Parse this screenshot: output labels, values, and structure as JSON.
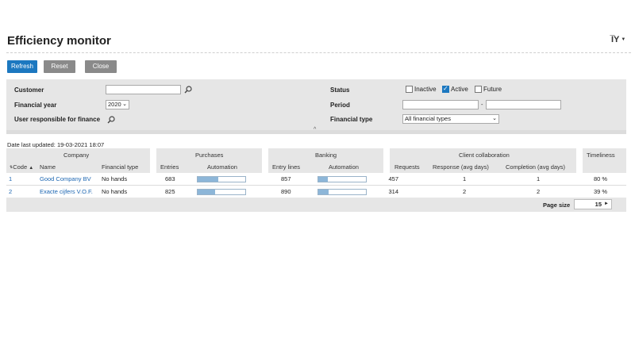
{
  "page": {
    "title": "Efficiency monitor",
    "menu_icon": "language-icon"
  },
  "toolbar": {
    "refresh": "Refresh",
    "reset": "Reset",
    "close": "Close"
  },
  "filters": {
    "customer_label": "Customer",
    "financial_year_label": "Financial year",
    "financial_year_value": "2020",
    "user_responsible_label": "User responsible for finance",
    "status_label": "Status",
    "status_options": [
      {
        "label": "Inactive",
        "checked": false
      },
      {
        "label": "Active",
        "checked": true
      },
      {
        "label": "Future",
        "checked": false
      }
    ],
    "period_label": "Period",
    "period_separator": "-",
    "financial_type_label": "Financial type",
    "financial_type_value": "All financial types",
    "collapse_icon": "^"
  },
  "meta": {
    "date_last_updated": "Date last updated: 19-03-2021 18:07"
  },
  "table": {
    "groups": {
      "company": "Company",
      "purchases": "Purchases",
      "banking": "Banking",
      "client_collaboration": "Client collaboration",
      "timeliness": "Timeliness"
    },
    "columns": {
      "code": "Code",
      "name": "Name",
      "financial_type": "Financial type",
      "entries": "Entries",
      "automation_purchases": "Automation",
      "entry_lines": "Entry lines",
      "automation_banking": "Automation",
      "requests": "Requests",
      "response": "Response (avg days)",
      "completion": "Completion (avg days)"
    },
    "sort_icon": "▲",
    "rows": [
      {
        "code": "1",
        "name": "Good Company BV",
        "financial_type": "No hands",
        "entries": "683",
        "purchases_automation": 0.44,
        "entry_lines": "857",
        "banking_automation": 0.2,
        "requests": "457",
        "response": "1",
        "completion": "1",
        "timeliness": "80 %"
      },
      {
        "code": "2",
        "name": "Exacte cijfers V.O.F.",
        "financial_type": "No hands",
        "entries": "825",
        "purchases_automation": 0.37,
        "entry_lines": "890",
        "banking_automation": 0.22,
        "requests": "314",
        "response": "2",
        "completion": "2",
        "timeliness": "39 %"
      }
    ]
  },
  "footer": {
    "page_size_label": "Page size",
    "page_size_value": "15"
  },
  "colors": {
    "primary": "#1c78c0",
    "button_gray": "#8a8a8a",
    "bar_fill": "#8db6d8",
    "link": "#1c66b2"
  }
}
